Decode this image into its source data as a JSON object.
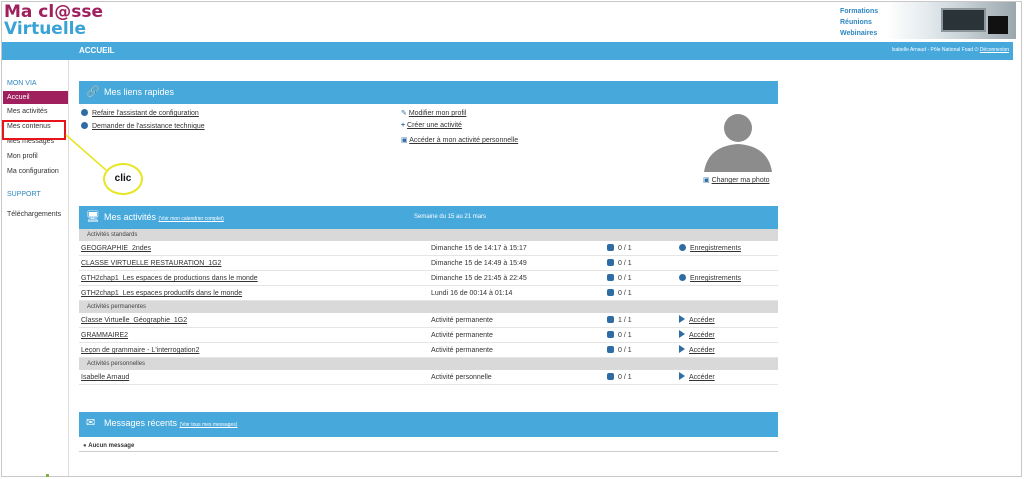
{
  "logo": {
    "line1": "Ma cl@sse",
    "line2": "Virtuelle"
  },
  "header_links": [
    "Formations",
    "Réunions",
    "Webinaires"
  ],
  "topbar": {
    "title": "ACCUEIL",
    "user": "Isabelle Arnaud - Pôle National Foad",
    "logout": "Déconnexion"
  },
  "sidebar": {
    "section1": "MON VIA",
    "items": [
      "Accueil",
      "Mes activités",
      "Mes contenus",
      "Mes messages",
      "Mon profil",
      "Ma configuration"
    ],
    "section2": "SUPPORT",
    "items2": [
      "Téléchargements"
    ]
  },
  "annotation": {
    "clic": "clic"
  },
  "quick_links": {
    "title": "Mes liens rapides",
    "left": [
      "Refaire l'assistant de configuration",
      "Demander de l'assistance technique"
    ],
    "right": [
      "Modifier mon profil",
      "Créer une activité",
      "Accéder à mon activité personnelle"
    ],
    "change_photo": "Changer ma photo"
  },
  "activities": {
    "title": "Mes activités",
    "subtitle": "(Voir mon calendrier complet)",
    "week": "Semaine du 15 au 21 mars",
    "sections": [
      {
        "label": "Activités standards",
        "rows": [
          {
            "name": "GEOGRAPHIE_2ndes",
            "when": "Dimanche 15 de 14:17 à 15:17",
            "count": "0 / 1",
            "action": "Enregistrements",
            "action_type": "record"
          },
          {
            "name": "CLASSE VIRTUELLE RESTAURATION_1G2",
            "when": "Dimanche 15 de 14:49 à 15:49",
            "count": "0 / 1",
            "action": "",
            "action_type": ""
          },
          {
            "name": "GTH2chap1_Les espaces de productions dans le monde",
            "when": "Dimanche 15 de 21:45 à 22:45",
            "count": "0 / 1",
            "action": "Enregistrements",
            "action_type": "record"
          },
          {
            "name": "GTH2chap1_Les espaces productifs dans le monde",
            "when": "Lundi 16 de 00:14 à 01:14",
            "count": "0 / 1",
            "action": "",
            "action_type": ""
          }
        ]
      },
      {
        "label": "Activités permanentes",
        "rows": [
          {
            "name": "Classe Virtuelle_Géographie_1G2",
            "when": "Activité permanente",
            "count": "1 / 1",
            "action": "Accéder",
            "action_type": "play"
          },
          {
            "name": "GRAMMAIRE2",
            "when": "Activité permanente",
            "count": "0 / 1",
            "action": "Accéder",
            "action_type": "play"
          },
          {
            "name": "Leçon de grammaire - L'interrogation2",
            "when": "Activité permanente",
            "count": "0 / 1",
            "action": "Accéder",
            "action_type": "play"
          }
        ]
      },
      {
        "label": "Activités personnelles",
        "rows": [
          {
            "name": "Isabelle Arnaud",
            "when": "Activité personnelle",
            "count": "0 / 1",
            "action": "Accéder",
            "action_type": "play"
          }
        ]
      }
    ]
  },
  "messages": {
    "title": "Messages récents",
    "subtitle": "(Voir tous mes messages)",
    "empty": "Aucun message"
  },
  "colors": {
    "brand_blue": "#47a8dc",
    "brand_purple": "#a0205e",
    "highlight_red": "#e8141b",
    "callout_yellow": "#e6e621"
  }
}
